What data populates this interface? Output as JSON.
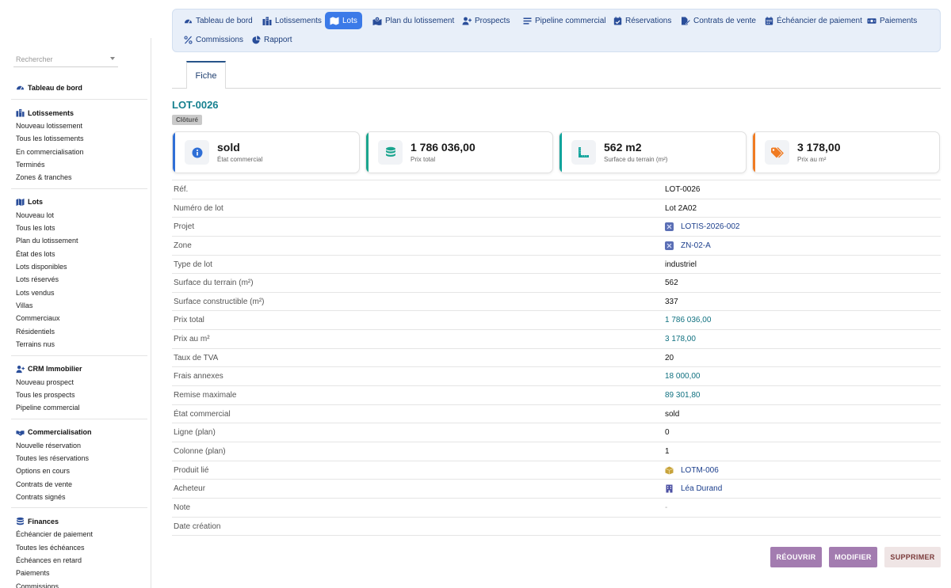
{
  "search": {
    "placeholder": "Rechercher"
  },
  "sidebar": {
    "sections": [
      {
        "title": "Tableau de bord",
        "icon": "dashboard-icon",
        "items": []
      },
      {
        "title": "Lotissements",
        "icon": "city-icon",
        "items": [
          "Nouveau lotissement",
          "Tous les lotissements",
          "En commercialisation",
          "Terminés",
          "Zones & tranches"
        ]
      },
      {
        "title": "Lots",
        "icon": "map-icon",
        "items": [
          "Nouveau lot",
          "Tous les lots",
          "Plan du lotissement",
          "État des lots",
          "Lots disponibles",
          "Lots réservés",
          "Lots vendus",
          "Villas",
          "Commerciaux",
          "Résidentiels",
          "Terrains nus"
        ]
      },
      {
        "title": "CRM Immobilier",
        "icon": "user-plus-icon",
        "items": [
          "Nouveau prospect",
          "Tous les prospects",
          "Pipeline commercial"
        ]
      },
      {
        "title": "Commercialisation",
        "icon": "handshake-icon",
        "items": [
          "Nouvelle réservation",
          "Toutes les réservations",
          "Options en cours",
          "Contrats de vente",
          "Contrats signés"
        ]
      },
      {
        "title": "Finances",
        "icon": "coins-icon",
        "items": [
          "Échéancier de paiement",
          "Toutes les échéances",
          "Échéances en retard",
          "Paiements",
          "Commissions"
        ]
      }
    ]
  },
  "topnav": {
    "items": [
      {
        "label": "Tableau de bord",
        "icon": "dashboard-icon",
        "active": false
      },
      {
        "label": "Lotissements",
        "icon": "city-icon",
        "active": false
      },
      {
        "label": "Lots",
        "icon": "map-icon",
        "active": true
      },
      {
        "label": "Plan du lotissement",
        "icon": "map-pin-icon",
        "active": false
      },
      {
        "label": "Prospects",
        "icon": "user-plus-icon",
        "active": false
      },
      {
        "label": "Pipeline commercial",
        "icon": "bars-icon",
        "active": false
      },
      {
        "label": "Réservations",
        "icon": "calendar-check-icon",
        "active": false
      },
      {
        "label": "Contrats de vente",
        "icon": "file-signature-icon",
        "active": false
      },
      {
        "label": "Échéancier de paiement",
        "icon": "calendar-icon",
        "active": false
      },
      {
        "label": "Paiements",
        "icon": "money-icon",
        "active": false
      },
      {
        "label": "Commissions",
        "icon": "percent-icon",
        "active": false
      },
      {
        "label": "Rapport",
        "icon": "pie-chart-icon",
        "active": false
      }
    ]
  },
  "tab": {
    "label": "Fiche"
  },
  "record": {
    "title": "LOT-0026",
    "status": "Clôturé"
  },
  "cards": [
    {
      "value": "sold",
      "label": "État commercial",
      "icon": "info-icon",
      "color": "#2f6fd6"
    },
    {
      "value": "1 786 036,00",
      "label": "Prix total",
      "icon": "coins-icon",
      "color": "#1aa58e"
    },
    {
      "value": "562 m2",
      "label": "Surface du terrain (m²)",
      "icon": "ruler-icon",
      "color": "#12a49c"
    },
    {
      "value": "3 178,00",
      "label": "Prix au m²",
      "icon": "tags-icon",
      "color": "#f07b22"
    }
  ],
  "details": [
    {
      "label": "Réf.",
      "value": "LOT-0026",
      "kind": "text"
    },
    {
      "label": "Numéro de lot",
      "value": "Lot 2A02",
      "kind": "text"
    },
    {
      "label": "Projet",
      "value": "LOTIS-2026-002",
      "kind": "link",
      "icon": "project-icon"
    },
    {
      "label": "Zone",
      "value": "ZN-02-A",
      "kind": "link",
      "icon": "zone-icon"
    },
    {
      "label": "Type de lot",
      "value": "industriel",
      "kind": "text"
    },
    {
      "label": "Surface du terrain (m²)",
      "value": "562",
      "kind": "text"
    },
    {
      "label": "Surface constructible (m²)",
      "value": "337",
      "kind": "text"
    },
    {
      "label": "Prix total",
      "value": "1 786 036,00",
      "kind": "money"
    },
    {
      "label": "Prix au m²",
      "value": "3 178,00",
      "kind": "money"
    },
    {
      "label": "Taux de TVA",
      "value": "20",
      "kind": "text"
    },
    {
      "label": "Frais annexes",
      "value": "18 000,00",
      "kind": "money"
    },
    {
      "label": "Remise maximale",
      "value": "89 301,80",
      "kind": "money"
    },
    {
      "label": "État commercial",
      "value": "sold",
      "kind": "text"
    },
    {
      "label": "Ligne (plan)",
      "value": "0",
      "kind": "text"
    },
    {
      "label": "Colonne (plan)",
      "value": "1",
      "kind": "text"
    },
    {
      "label": "Produit lié",
      "value": "LOTM-006",
      "kind": "link",
      "icon": "box-icon"
    },
    {
      "label": "Acheteur",
      "value": "Léa Durand",
      "kind": "link",
      "icon": "building-icon"
    },
    {
      "label": "Note",
      "value": "-",
      "kind": "muted"
    },
    {
      "label": "Date création",
      "value": "",
      "kind": "text"
    }
  ],
  "actions": {
    "reopen": "RÉOUVRIR",
    "edit": "MODIFIER",
    "delete": "SUPPRIMER"
  }
}
